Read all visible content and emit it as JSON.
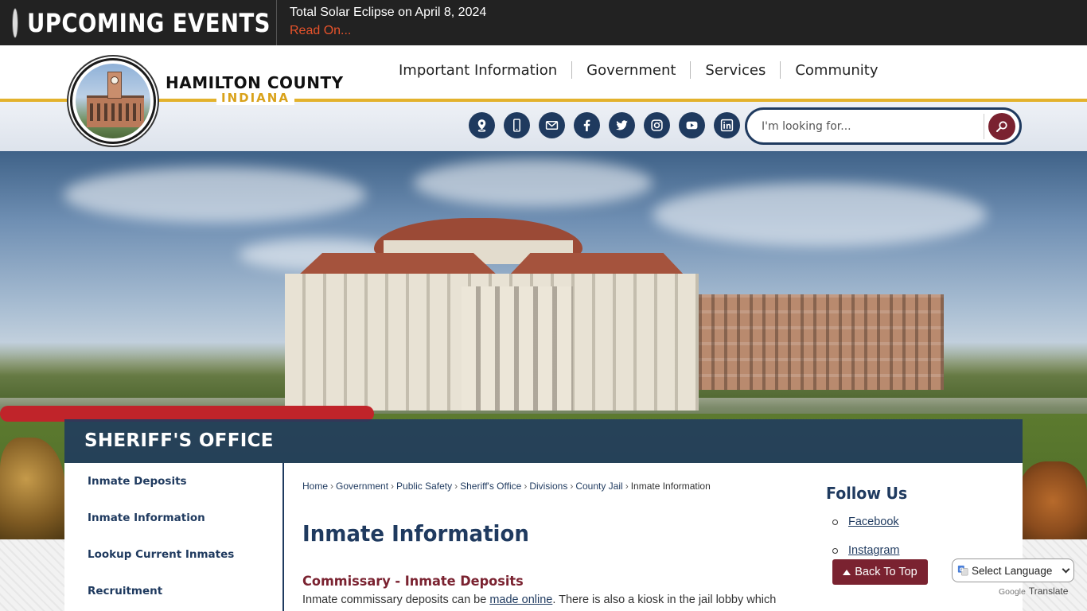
{
  "events_bar": {
    "label": "UPCOMING EVENTS",
    "event_title": "Total Solar Eclipse on April 8, 2024",
    "read_on": "Read On..."
  },
  "logo": {
    "line1": "HAMILTON COUNTY",
    "line2": "INDIANA"
  },
  "main_nav": [
    "Important Information",
    "Government",
    "Services",
    "Community"
  ],
  "social_icons": [
    "map-pin-icon",
    "mobile-phone-icon",
    "email-icon",
    "facebook-icon",
    "twitter-icon",
    "instagram-icon",
    "youtube-icon",
    "linkedin-icon"
  ],
  "search": {
    "placeholder": "I'm looking for..."
  },
  "department": {
    "title": "SHERIFF'S OFFICE"
  },
  "side_nav": [
    "Inmate Deposits",
    "Inmate Information",
    "Lookup Current Inmates",
    "Recruitment"
  ],
  "breadcrumb": {
    "links": [
      "Home",
      "Government",
      "Public Safety",
      "Sheriff's Office",
      "Divisions",
      "County Jail"
    ],
    "current": "Inmate Information"
  },
  "main": {
    "page_title": "Inmate Information",
    "section_heading": "Commissary - Inmate Deposits",
    "body_prefix": "Inmate commissary deposits can be ",
    "body_link": "made online",
    "body_suffix": ". There is also a kiosk in the jail lobby which"
  },
  "follow_us": {
    "title": "Follow Us",
    "links": [
      "Facebook",
      "Instagram"
    ]
  },
  "back_to_top": "Back To Top",
  "translate": {
    "select_label": "Select Language",
    "powered_by": "Google",
    "translate_word": "Translate"
  },
  "colors": {
    "navy": "#1f3a5f",
    "maroon": "#7a2230",
    "gold": "#e3b22c",
    "event_link": "#e8532b"
  }
}
